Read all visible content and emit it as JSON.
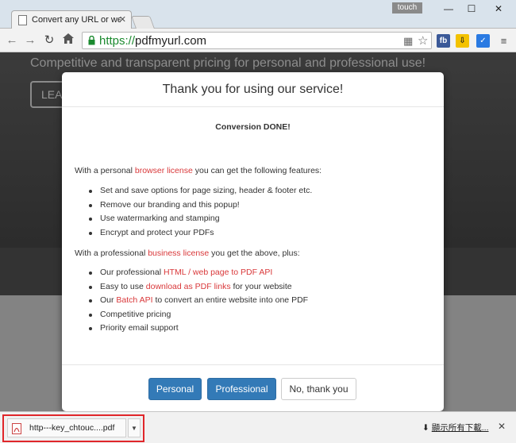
{
  "browser": {
    "tab_title": "Convert any URL or web",
    "tab_close": "✕",
    "touch_label": "touch",
    "win_min": "—",
    "win_max": "☐",
    "win_close": "✕",
    "url_scheme": "https://",
    "url_host": "pdfmyurl.com",
    "ext_fb": "fb"
  },
  "page": {
    "hero_text": "Competitive and transparent pricing for personal and professional use!",
    "learn_label": "LEA"
  },
  "modal": {
    "title": "Thank you for using our service!",
    "done": "Conversion DONE!",
    "personal_intro_pre": "With a personal ",
    "personal_link": "browser license",
    "personal_intro_post": " you can get the following features:",
    "personal_features": [
      "Set and save options for page sizing, header & footer etc.",
      "Remove our branding and this popup!",
      "Use watermarking and stamping",
      "Encrypt and protect your PDFs"
    ],
    "pro_intro_pre": "With a professional ",
    "pro_link": "business license",
    "pro_intro_post": " you get the above, plus:",
    "pro_features": {
      "api_pre": "Our professional ",
      "api_link": "HTML / web page to PDF API",
      "links_pre": "Easy to use ",
      "links_link": "download as PDF links",
      "links_post": " for your website",
      "batch_pre": "Our ",
      "batch_link": "Batch API",
      "batch_post": " to convert an entire website into one PDF",
      "pricing": "Competitive pricing",
      "support": "Priority email support"
    },
    "buttons": {
      "personal": "Personal",
      "professional": "Professional",
      "no_thanks": "No, thank you"
    }
  },
  "downloads": {
    "filename": "http---key_chtouc....pdf",
    "show_all": "顯示所有下載...",
    "close": "✕"
  },
  "colors": {
    "link_red": "#d9383a",
    "primary_blue": "#337ab7",
    "url_green": "#1b8a2f",
    "highlight_red": "#e0262a"
  }
}
